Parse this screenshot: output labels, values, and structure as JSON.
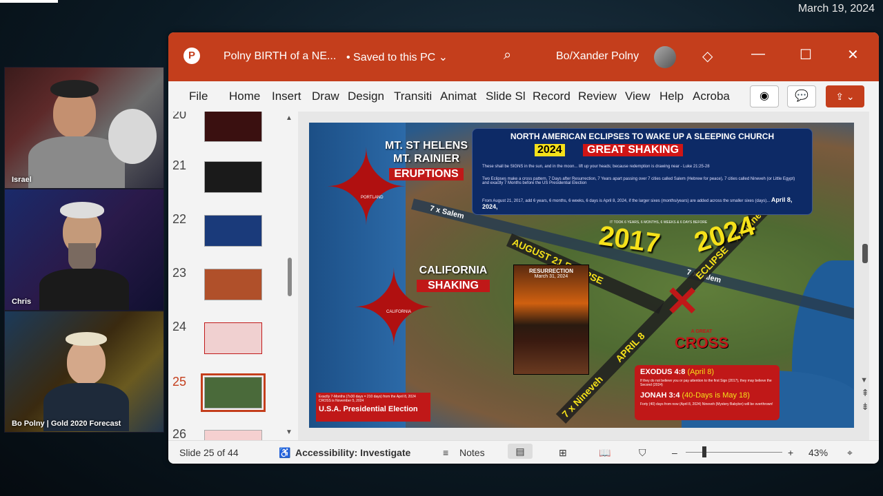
{
  "overlay": {
    "date": "March 19, 2024"
  },
  "cams": [
    {
      "label": "Israel"
    },
    {
      "label": "Chris"
    },
    {
      "label": "Bo Polny | Gold 2020 Forecast"
    }
  ],
  "titlebar": {
    "file_name": "Polny BIRTH of a NE...",
    "saved_status": "• Saved to this PC",
    "user": "Bo/Xander Polny",
    "accent": "#c43e1c"
  },
  "ribbon": {
    "tabs": [
      "File",
      "Home",
      "Insert",
      "Draw",
      "Design",
      "Transiti",
      "Animat",
      "Slide Sl",
      "Record",
      "Review",
      "View",
      "Help",
      "Acroba"
    ]
  },
  "thumbnails": {
    "numbers": [
      "20",
      "21",
      "22",
      "23",
      "24",
      "25",
      "26"
    ],
    "selected": "25"
  },
  "slide": {
    "header_title": "NORTH AMERICAN ECLIPSES TO WAKE UP A SLEEPING CHURCH",
    "header_year": "2024",
    "header_tag": "GREAT SHAKING",
    "p1": "These shall be SIGNS in the sun, and in the moon... lift up your heads; because redemption is drawing near - Luke 21:25-28",
    "p2": "Two Eclipses make a cross pattern. 7 Days after Resurrection, 7 Years apart passing over 7 cities called Salem (Hebrew for peace), 7 cities called Nineveh (or Little Egypt) and exactly 7 Months before the US Presidential Election",
    "p3": "From August 21, 2017, add 6 years, 6 months, 6 weeks, 6 days is April 8, 2024, if the larger sixes (months/years) are added across the smaller sixes (days)...",
    "p3_date": "April 8, 2024,",
    "helens": "MT. ST HELENS",
    "rainier": "MT. RAINIER",
    "eruptions": "ERUPTIONS",
    "portland": "PORTLAND",
    "california": "CALIFORNIA",
    "shaking": "SHAKING",
    "california_small": "CALIFORNIA",
    "salem1": "7 x Salem",
    "salem2": "7 x Salem",
    "aug_eclipse": "AUGUST 21 ECLIPSE",
    "year2017": "2017",
    "year2024": "2024",
    "eclipse2024": "ECLIPSE",
    "nineveh1": "7 x Nineveh",
    "april": "APRIL 8",
    "nineveh2": "7 x Nineveh",
    "small_note": "IT TOOK 6 YEARS, 6 MONTHS, 6 WEEKS & 6 DAYS BEFORE",
    "photo_title": "RESURRECTION",
    "photo_sub": "March 31, 2024",
    "cross": "CROSS",
    "cross_pre": "A GREAT",
    "exodus": "EXODUS 4:8",
    "exodus_date": "(April 8)",
    "exodus_text": "If they do not believe you or pay attention to the first Sign (2017), they may believe the Second (2024)",
    "jonah": "JONAH 3:4",
    "jonah_date": "(40-Days is May 18)",
    "jonah_text": "Forty (40) days from now (April 8, 2024) Nineveh (Mystery Babylon) will be overthrown!",
    "election_small": "Exactly 7-Months (7x30 days = 210 days) from the April 8, 2024 CROSS is November 5, 2024",
    "election": "U.S.A. Presidential Election"
  },
  "statusbar": {
    "slide_info": "Slide 25 of 44",
    "accessibility": "Accessibility: Investigate",
    "notes": "Notes",
    "zoom": "43%"
  }
}
